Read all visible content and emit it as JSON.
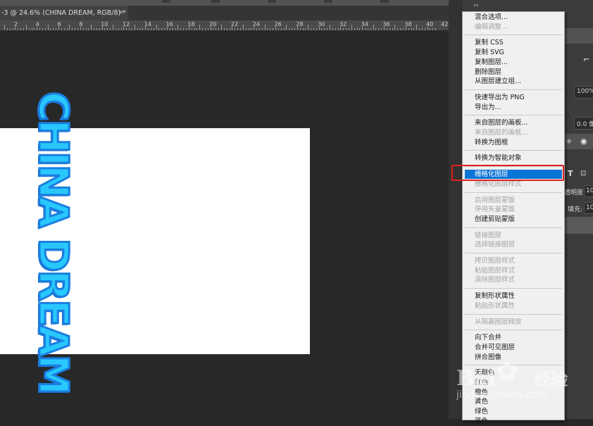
{
  "document": {
    "tab_title": "-3 @ 24.6% (CHINA DREAM, RGB/8) *",
    "tab_close": "×",
    "ruler_numbers": [
      "2",
      "4",
      "6",
      "8",
      "10",
      "12",
      "14",
      "16",
      "18",
      "20",
      "22",
      "24",
      "26",
      "28",
      "30",
      "32",
      "34",
      "36",
      "38",
      "40"
    ],
    "ruler_end": "42"
  },
  "canvas": {
    "text_layer": "CHINA DREAM",
    "text_color": "#28c8ff",
    "outline_color": "#1a7fe0"
  },
  "right_panel": {
    "collapse": "‹‹",
    "zoom_value": "100%",
    "size_value": "0.0 像",
    "opacity_label": "透明度:",
    "opacity_value": "10",
    "fill_label": "填充:",
    "fill_value": "10",
    "type_icon": "T",
    "eye_icon": "eye-icon"
  },
  "context_menu": {
    "groups": [
      [
        {
          "label": "混合选项...",
          "enabled": true
        },
        {
          "label": "编辑调整...",
          "enabled": false
        }
      ],
      [
        {
          "label": "复制 CSS",
          "enabled": true
        },
        {
          "label": "复制 SVG",
          "enabled": true
        },
        {
          "label": "复制图层...",
          "enabled": true
        },
        {
          "label": "删除图层",
          "enabled": true
        },
        {
          "label": "从图层建立组...",
          "enabled": true
        }
      ],
      [
        {
          "label": "快速导出为 PNG",
          "enabled": true
        },
        {
          "label": "导出为...",
          "enabled": true
        }
      ],
      [
        {
          "label": "来自图层的画板...",
          "enabled": true
        },
        {
          "label": "来自图层的画框...",
          "enabled": false
        },
        {
          "label": "转换为图框",
          "enabled": true
        }
      ],
      [
        {
          "label": "转换为智能对象",
          "enabled": true
        }
      ],
      [
        {
          "label": "栅格化图层",
          "enabled": true,
          "highlighted": true
        },
        {
          "label": "栅格化图层样式",
          "enabled": false
        }
      ],
      [
        {
          "label": "启用图层蒙版",
          "enabled": false
        },
        {
          "label": "停用矢量蒙版",
          "enabled": false
        },
        {
          "label": "创建剪贴蒙版",
          "enabled": true
        }
      ],
      [
        {
          "label": "链接图层",
          "enabled": false
        },
        {
          "label": "选择链接图层",
          "enabled": false
        }
      ],
      [
        {
          "label": "拷贝图层样式",
          "enabled": false
        },
        {
          "label": "粘贴图层样式",
          "enabled": false
        },
        {
          "label": "清除图层样式",
          "enabled": false
        }
      ],
      [
        {
          "label": "复制形状属性",
          "enabled": true
        },
        {
          "label": "粘贴形状属性",
          "enabled": false
        }
      ],
      [
        {
          "label": "从隔离图层释放",
          "enabled": false
        }
      ],
      [
        {
          "label": "向下合并",
          "enabled": true
        },
        {
          "label": "合并可见图层",
          "enabled": true
        },
        {
          "label": "拼合图像",
          "enabled": true
        }
      ],
      [
        {
          "label": "无颜色",
          "enabled": true
        },
        {
          "label": "红色",
          "enabled": true
        },
        {
          "label": "橙色",
          "enabled": true
        },
        {
          "label": "黄色",
          "enabled": true
        },
        {
          "label": "绿色",
          "enabled": true
        },
        {
          "label": "蓝色",
          "enabled": true
        }
      ]
    ],
    "highlight_color": "#0a74d6"
  },
  "watermark": {
    "brand": "Bai",
    "brand_cn": "经验",
    "url": "jingyan.baidu.com"
  }
}
